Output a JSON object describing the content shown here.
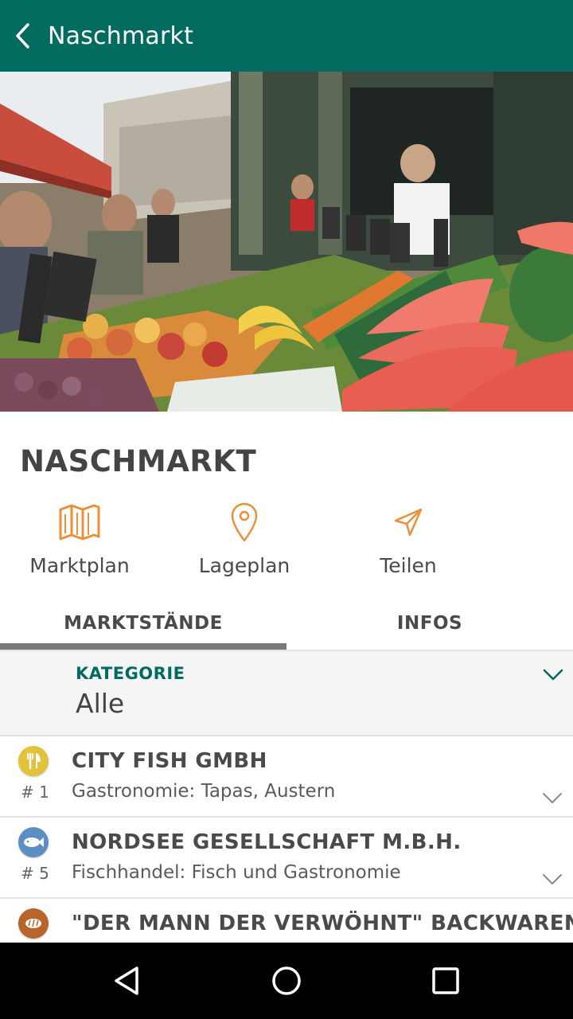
{
  "header": {
    "title": "Naschmarkt",
    "back_icon": "chevron-left-icon"
  },
  "market": {
    "title": "NASCHMARKT"
  },
  "actions": [
    {
      "label": "Marktplan",
      "icon": "map-icon"
    },
    {
      "label": "Lageplan",
      "icon": "location-pin-icon"
    },
    {
      "label": "Teilen",
      "icon": "send-icon"
    }
  ],
  "tabs": [
    {
      "label": "MARKTSTÄNDE",
      "active": true
    },
    {
      "label": "INFOS",
      "active": false
    }
  ],
  "filter": {
    "label": "KATEGORIE",
    "value": "Alle"
  },
  "stalls": [
    {
      "number": "# 1",
      "name": "CITY FISH GMBH",
      "category": "Gastronomie: Tapas, Austern",
      "icon": "fork-knife-icon",
      "color": "#e2c23a"
    },
    {
      "number": "# 5",
      "name": "NORDSEE GESELLSCHAFT M.B.H.",
      "category": "Fischhandel: Fisch und Gastronomie",
      "icon": "fish-icon",
      "color": "#5b8fc4"
    },
    {
      "number": "",
      "name": "\"DER MANN DER VERWÖHNT\" BACKWAREN",
      "category": "",
      "icon": "bread-icon",
      "color": "#b7652a"
    }
  ],
  "colors": {
    "primary": "#006b5e",
    "accent": "#e8903a"
  }
}
